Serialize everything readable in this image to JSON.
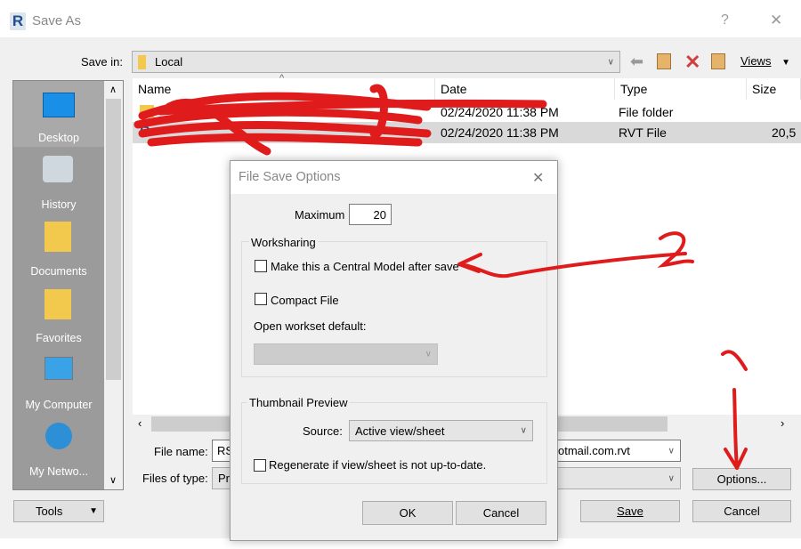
{
  "window": {
    "title": "Save As",
    "help": "?",
    "close": "✕"
  },
  "save_in": {
    "label": "Save in:",
    "value": "Local",
    "views_label": "Views"
  },
  "toolbar_icons": [
    "back-arrow-icon",
    "up-folder-icon",
    "delete-icon",
    "new-folder-icon"
  ],
  "sidebar": {
    "items": [
      {
        "label": "Desktop",
        "icon": "desktop-icon"
      },
      {
        "label": "History",
        "icon": "history-icon"
      },
      {
        "label": "Documents",
        "icon": "documents-icon"
      },
      {
        "label": "Favorites",
        "icon": "favorites-icon"
      },
      {
        "label": "My Computer",
        "icon": "computer-icon"
      },
      {
        "label": "My Netwo...",
        "icon": "network-icon"
      }
    ]
  },
  "file_list": {
    "columns": [
      "Name",
      "Date",
      "Type",
      "Size"
    ],
    "rows": [
      {
        "date": "02/24/2020 11:38 PM",
        "type": "File folder",
        "size": ""
      },
      {
        "date": "02/24/2020 11:38 PM",
        "type": "RVT File",
        "size": "20,5"
      }
    ]
  },
  "file_name": {
    "label": "File name:",
    "value_start": "RS",
    "value_end": "otmail.com.rvt"
  },
  "files_of_type": {
    "label": "Files of type:",
    "value_start": "Pro"
  },
  "buttons": {
    "options": "Options...",
    "save": "Save",
    "cancel": "Cancel",
    "tools": "Tools"
  },
  "options_dialog": {
    "title": "File Save Options",
    "close": "✕",
    "maximum_label": "Maximum",
    "maximum_value": "20",
    "worksharing": {
      "title": "Worksharing",
      "central_model": "Make this a Central Model after save",
      "central_model_checked": false,
      "compact": "Compact File",
      "compact_checked": false,
      "workset_label": "Open workset default:",
      "workset_value": ""
    },
    "thumbnail": {
      "title": "Thumbnail Preview",
      "source_label": "Source:",
      "source_value": "Active view/sheet",
      "regenerate": "Regenerate if view/sheet is not up-to-date.",
      "regenerate_checked": false
    },
    "ok": "OK",
    "cancel": "Cancel"
  },
  "annotations": {
    "one": "1",
    "two": "2",
    "color": "#e01b1b"
  }
}
